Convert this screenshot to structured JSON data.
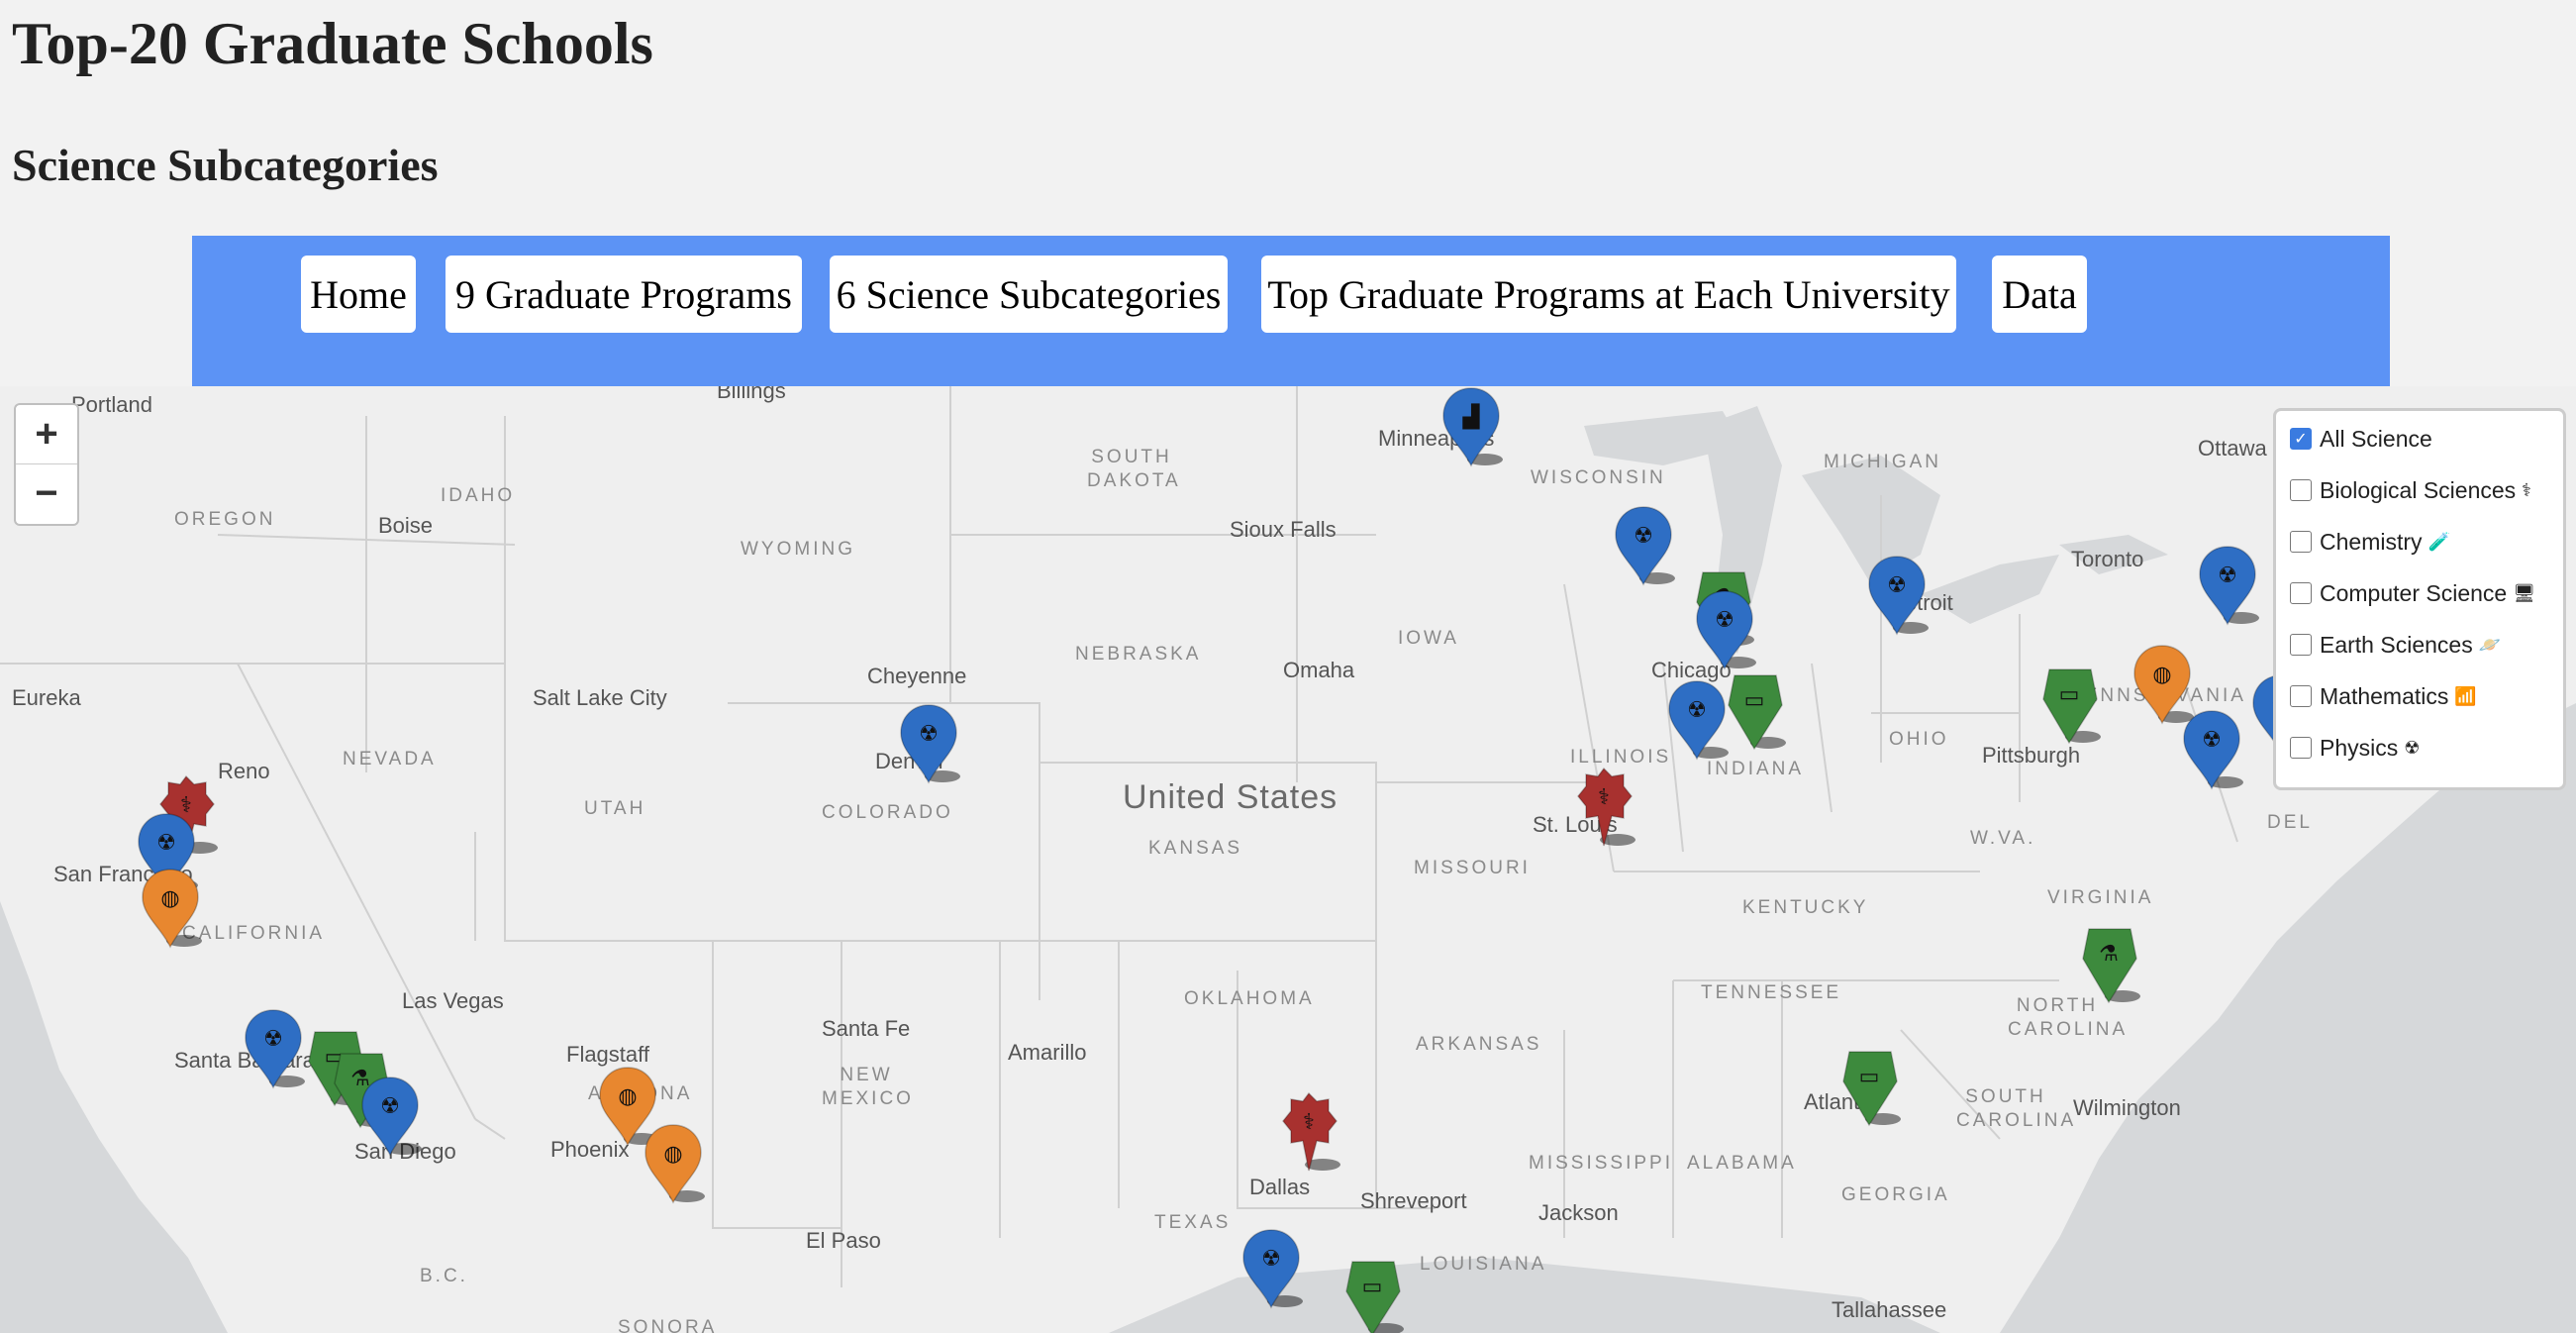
{
  "page": {
    "title": "Top-20 Graduate Schools",
    "subtitle": "Science Subcategories"
  },
  "nav": {
    "items": [
      {
        "label": "Home"
      },
      {
        "label": "9 Graduate Programs"
      },
      {
        "label": "6 Science Subcategories"
      },
      {
        "label": "Top Graduate Programs at Each University"
      },
      {
        "label": "Data"
      }
    ]
  },
  "map": {
    "zoom_in": "+",
    "zoom_out": "−",
    "country_label": "United States",
    "cities": [
      "Portland",
      "Billings",
      "Minneapolis",
      "Boise",
      "Sioux Falls",
      "Toronto",
      "Ottawa",
      "Eureka",
      "Reno",
      "Salt Lake City",
      "Cheyenne",
      "Omaha",
      "Chicago",
      "Detroit",
      "Pittsburgh",
      "Denver",
      "St. Louis",
      "San Francisco",
      "Las Vegas",
      "Santa Barbara",
      "San Diego",
      "Flagstaff",
      "Phoenix",
      "Santa Fe",
      "Amarillo",
      "El Paso",
      "Dallas",
      "Shreveport",
      "Jackson",
      "Atlanta",
      "Wilmington",
      "Tallahassee"
    ],
    "states": [
      "OREGON",
      "IDAHO",
      "WYOMING",
      "SOUTH DAKOTA",
      "NEBRASKA",
      "IOWA",
      "WISCONSIN",
      "MICHIGAN",
      "NEVADA",
      "UTAH",
      "COLORADO",
      "KANSAS",
      "MISSOURI",
      "ILLINOIS",
      "INDIANA",
      "OHIO",
      "PENNSYLVANIA",
      "W.VA.",
      "KENTUCKY",
      "VIRGINIA",
      "CALIFORNIA",
      "ARIZONA",
      "NEW MEXICO",
      "OKLAHOMA",
      "ARKANSAS",
      "TENNESSEE",
      "NORTH CAROLINA",
      "SOUTH CAROLINA",
      "TEXAS",
      "MISSISSIPPI",
      "ALABAMA",
      "GEORGIA",
      "LOUISIANA",
      "SONORA",
      "B.C.",
      "DEL"
    ],
    "colors": {
      "biological": "#a8312f",
      "chemistry": "#3d8a3d",
      "computer": "#3d8a3d",
      "earth": "#e8872f",
      "mathematics": "#2e6ec4",
      "physics": "#2e6ec4"
    }
  },
  "legend": {
    "items": [
      {
        "label": "All Science",
        "checked": true,
        "icon": ""
      },
      {
        "label": "Biological Sciences",
        "checked": false,
        "icon": "⚕"
      },
      {
        "label": "Chemistry",
        "checked": false,
        "icon": "🧪"
      },
      {
        "label": "Computer Science",
        "checked": false,
        "icon": "🖥"
      },
      {
        "label": "Earth Sciences",
        "checked": false,
        "icon": "🪐"
      },
      {
        "label": "Mathematics",
        "checked": false,
        "icon": "📶"
      },
      {
        "label": "Physics",
        "checked": false,
        "icon": "☢"
      }
    ]
  },
  "markers": [
    {
      "kind": "mathematics",
      "color": "#2e6ec4",
      "place": "Minneapolis"
    },
    {
      "kind": "physics",
      "color": "#2e6ec4",
      "place": "Madison"
    },
    {
      "kind": "chemistry",
      "color": "#3d8a3d",
      "place": "Chicago"
    },
    {
      "kind": "physics",
      "color": "#2e6ec4",
      "place": "Chicago"
    },
    {
      "kind": "physics",
      "color": "#2e6ec4",
      "place": "Ann Arbor"
    },
    {
      "kind": "physics",
      "color": "#2e6ec4",
      "place": "Ithaca"
    },
    {
      "kind": "computer",
      "color": "#3d8a3d",
      "place": "Pittsburgh"
    },
    {
      "kind": "earth",
      "color": "#e8872f",
      "place": "State College"
    },
    {
      "kind": "physics",
      "color": "#2e6ec4",
      "place": "Princeton"
    },
    {
      "kind": "physics",
      "color": "#2e6ec4",
      "place": "Baltimore"
    },
    {
      "kind": "physics",
      "color": "#2e6ec4",
      "place": "Champaign"
    },
    {
      "kind": "computer",
      "color": "#3d8a3d",
      "place": "Indiana"
    },
    {
      "kind": "biological",
      "color": "#a8312f",
      "place": "St. Louis"
    },
    {
      "kind": "physics",
      "color": "#2e6ec4",
      "place": "Boulder"
    },
    {
      "kind": "biological",
      "color": "#a8312f",
      "place": "Berkeley"
    },
    {
      "kind": "physics",
      "color": "#2e6ec4",
      "place": "Berkeley"
    },
    {
      "kind": "earth",
      "color": "#e8872f",
      "place": "Stanford"
    },
    {
      "kind": "physics",
      "color": "#2e6ec4",
      "place": "Santa Barbara"
    },
    {
      "kind": "computer",
      "color": "#3d8a3d",
      "place": "Los Angeles"
    },
    {
      "kind": "chemistry",
      "color": "#3d8a3d",
      "place": "Irvine"
    },
    {
      "kind": "physics",
      "color": "#2e6ec4",
      "place": "San Diego"
    },
    {
      "kind": "earth",
      "color": "#e8872f",
      "place": "Flagstaff"
    },
    {
      "kind": "earth",
      "color": "#e8872f",
      "place": "Tempe"
    },
    {
      "kind": "biological",
      "color": "#a8312f",
      "place": "Dallas"
    },
    {
      "kind": "physics",
      "color": "#2e6ec4",
      "place": "Austin"
    },
    {
      "kind": "computer",
      "color": "#3d8a3d",
      "place": "Austin"
    },
    {
      "kind": "computer",
      "color": "#3d8a3d",
      "place": "Atlanta"
    },
    {
      "kind": "chemistry",
      "color": "#3d8a3d",
      "place": "Chapel Hill"
    }
  ]
}
